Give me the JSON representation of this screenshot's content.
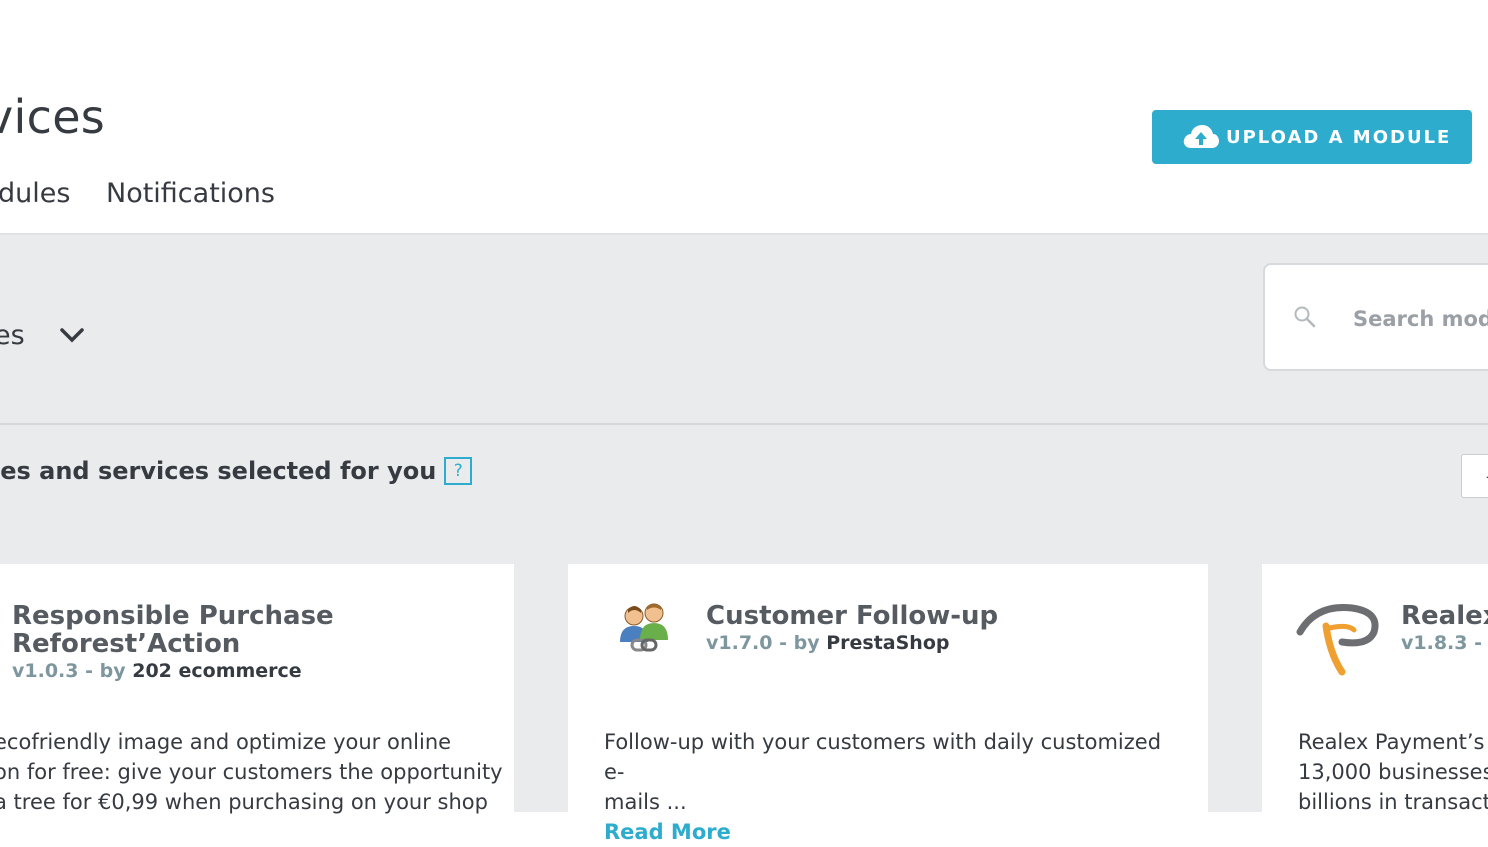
{
  "header": {
    "title": "vices",
    "upload_button": "UPLOAD A MODULE",
    "tabs": [
      {
        "label": "dules"
      },
      {
        "label": "Notifications"
      }
    ]
  },
  "toolbar": {
    "category_select": "es",
    "search_placeholder": "Search modu"
  },
  "section": {
    "title": "les and services selected for you",
    "help": "?"
  },
  "modules": [
    {
      "name_line1": "Responsible Purchase",
      "name_line2": "Reforest’Action",
      "version": "v1.0.3 - by",
      "author": "202 ecommerce",
      "desc_lines": [
        " ecofriendly image and optimize your online",
        "on for free: give your customers the opportunity",
        "a tree for €0,99 when purchasing on your shop"
      ]
    },
    {
      "name": "Customer Follow-up",
      "version": "v1.7.0 - by",
      "author": "PrestaShop",
      "desc_lines": [
        "Follow-up with your customers with daily customized e-",
        "mails ..."
      ],
      "read_more": "Read More"
    },
    {
      "name": "Realex",
      "version": "v1.8.3 - by",
      "desc_lines": [
        "Realex Payment’s c",
        "13,000 businesses",
        "billions in transacti"
      ]
    }
  ],
  "colors": {
    "accent": "#2eacce",
    "background": "#eaebec",
    "text": "#363a41"
  }
}
